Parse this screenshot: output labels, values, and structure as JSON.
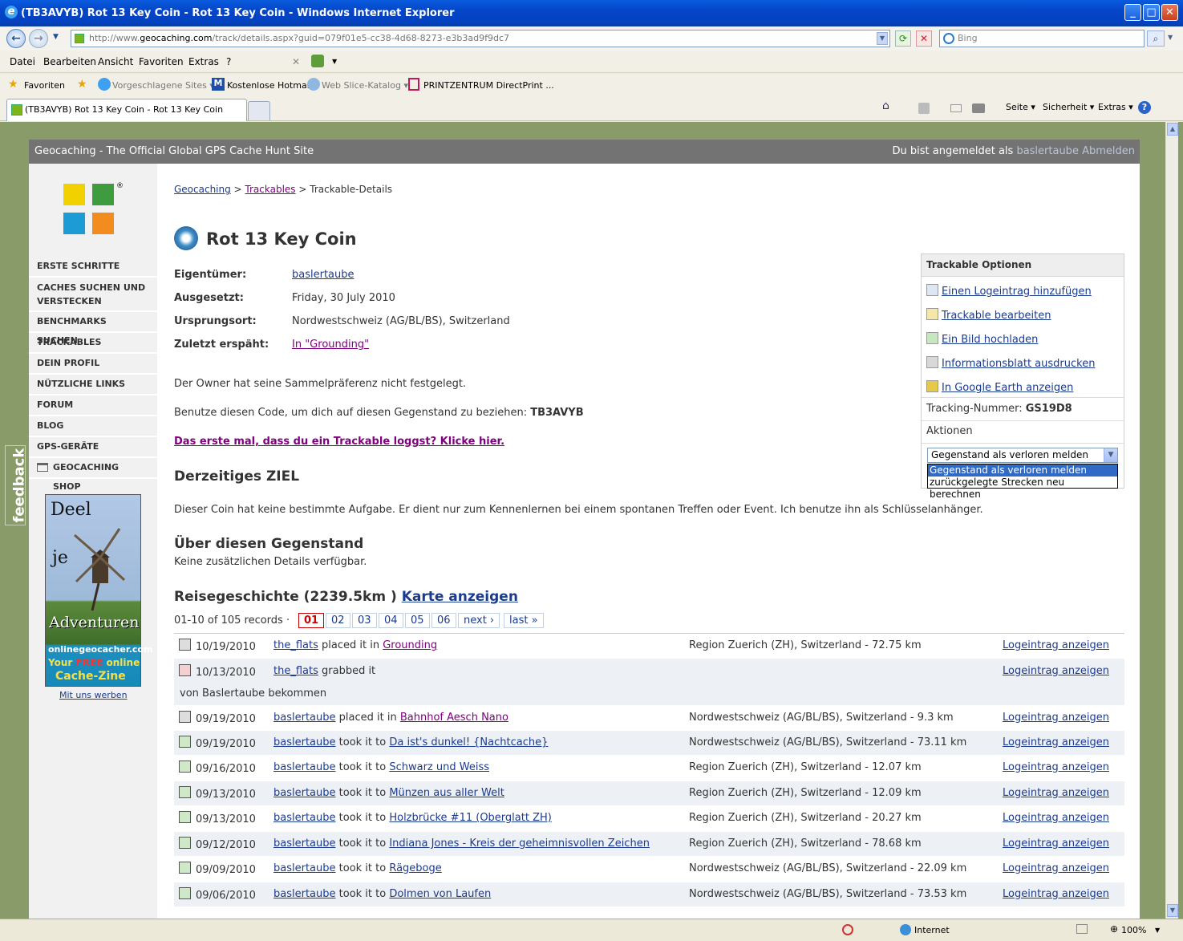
{
  "window": {
    "title": "(TB3AVYB) Rot 13 Key Coin - Rot 13 Key Coin - Windows Internet Explorer"
  },
  "browser": {
    "url_prefix": "http://www.",
    "url_domain": "geocaching.com",
    "url_rest": "/track/details.aspx?guid=079f01e5-cc38-4d68-8273-e3b3ad9f9dc7",
    "search_placeholder": "Bing",
    "menu": [
      "Datei",
      "Bearbeiten",
      "Ansicht",
      "Favoriten",
      "Extras",
      "?"
    ],
    "favorites_label": "Favoriten",
    "favorites": [
      "Vorgeschlagene Sites ▾",
      "Kostenlose Hotmail",
      "Web Slice-Katalog ▾",
      "PRINTZENTRUM DirectPrint ..."
    ],
    "tab_title": "(TB3AVYB) Rot 13 Key Coin - Rot 13 Key Coin",
    "tools": [
      "Seite ▾",
      "Sicherheit ▾",
      "Extras ▾"
    ],
    "status_zone": "Internet",
    "zoom": "100%"
  },
  "site": {
    "header_title": "Geocaching - The Official Global GPS Cache Hunt Site",
    "logged_in_prefix": "Du bist angemeldet als",
    "username": "baslertaube",
    "logout": "Abmelden"
  },
  "sidebar": {
    "items": [
      "ERSTE SCHRITTE",
      "CACHES SUCHEN UND VERSTECKEN",
      "BENCHMARKS SUCHEN",
      "TRACKABLES",
      "DEIN PROFIL",
      "NÜTZLICHE LINKS",
      "FORUM",
      "BLOG",
      "GPS-GERÄTE",
      "GEOCACHING SHOP"
    ],
    "ad_lines": [
      "Deel",
      "je",
      "Adventuren",
      "onlinegeocacher.com",
      "Your",
      "FREE",
      "online",
      "Cache-Zine"
    ],
    "ad_link": "Mit uns werben",
    "feedback": "feedback"
  },
  "breadcrumb": {
    "home": "Geocaching",
    "trackables": "Trackables",
    "current": "Trackable-Details"
  },
  "trackable": {
    "name": "Rot 13 Key Coin",
    "fields": [
      {
        "label": "Eigentümer:",
        "value": "baslertaube"
      },
      {
        "label": "Ausgesetzt:",
        "value": "Friday, 30 July 2010"
      },
      {
        "label": "Ursprungsort:",
        "value": "Nordwestschweiz (AG/BL/BS), Switzerland"
      },
      {
        "label": "Zuletzt erspäht:",
        "value": "In \"Grounding\""
      }
    ],
    "collect_pref": "Der Owner hat seine Sammelpräferenz nicht festgelegt.",
    "code_text": "Benutze diesen Code, um dich auf diesen Gegenstand zu beziehen:",
    "code": "TB3AVYB",
    "first_log_link": "Das erste mal, dass du ein Trackable loggst? Klicke hier.",
    "goal_heading": "Derzeitiges ZIEL",
    "goal_text": "Dieser Coin hat keine bestimmte Aufgabe. Er dient nur zum Kennenlernen bei einem spontanen Treffen oder Event. Ich benutze ihn als Schlüsselanhänger.",
    "about_heading": "Über diesen Gegenstand",
    "about_text": "Keine zusätzlichen Details verfügbar.",
    "travel_heading": "Reisegeschichte (2239.5km )",
    "map_link": "Karte anzeigen"
  },
  "options": {
    "title": "Trackable Optionen",
    "links": [
      "Einen Logeintrag hinzufügen",
      "Trackable bearbeiten",
      "Ein Bild hochladen",
      "Informationsblatt ausdrucken",
      "In Google Earth anzeigen"
    ],
    "tracking_label": "Tracking-Nummer:",
    "tracking_number": "GS19D8",
    "actions_label": "Aktionen",
    "select_value": "Gegenstand als verloren melden",
    "select_options": [
      "Gegenstand als verloren melden",
      "zurückgelegte Strecken neu berechnen"
    ]
  },
  "pager": {
    "records": "01-10 of 105 records ·",
    "pages": [
      "01",
      "02",
      "03",
      "04",
      "05",
      "06"
    ],
    "current": "01",
    "next": "next ›",
    "last": "last »"
  },
  "logs": [
    {
      "date": "10/19/2010",
      "user": "the_flats",
      "action": "placed it in",
      "target": "Grounding",
      "target_visited": true,
      "location": "Region Zuerich (ZH), Switzerland - 72.75 km",
      "link": "Logeintrag anzeigen"
    },
    {
      "date": "10/13/2010",
      "user": "the_flats",
      "action": "grabbed it",
      "target": "",
      "location": "",
      "note": "von Baslertaube bekommen",
      "link": "Logeintrag anzeigen"
    },
    {
      "date": "09/19/2010",
      "user": "baslertaube",
      "action": "placed it in",
      "target": "Bahnhof Aesch Nano",
      "target_visited": true,
      "location": "Nordwestschweiz (AG/BL/BS), Switzerland - 9.3 km",
      "link": "Logeintrag anzeigen"
    },
    {
      "date": "09/19/2010",
      "user": "baslertaube",
      "action": "took it to",
      "target": "Da ist's dunkel! {Nachtcache}",
      "location": "Nordwestschweiz (AG/BL/BS), Switzerland - 73.11 km",
      "link": "Logeintrag anzeigen"
    },
    {
      "date": "09/16/2010",
      "user": "baslertaube",
      "action": "took it to",
      "target": "Schwarz und Weiss",
      "location": "Region Zuerich (ZH), Switzerland - 12.07 km",
      "link": "Logeintrag anzeigen"
    },
    {
      "date": "09/13/2010",
      "user": "baslertaube",
      "action": "took it to",
      "target": "Münzen aus aller Welt",
      "location": "Region Zuerich (ZH), Switzerland - 12.09 km",
      "link": "Logeintrag anzeigen"
    },
    {
      "date": "09/13/2010",
      "user": "baslertaube",
      "action": "took it to",
      "target": "Holzbrücke #11 (Oberglatt ZH)",
      "location": "Region Zuerich (ZH), Switzerland - 20.27 km",
      "link": "Logeintrag anzeigen"
    },
    {
      "date": "09/12/2010",
      "user": "baslertaube",
      "action": "took it to",
      "target": "Indiana Jones - Kreis der geheimnisvollen Zeichen",
      "location": "Region Zuerich (ZH), Switzerland - 78.68 km",
      "link": "Logeintrag anzeigen"
    },
    {
      "date": "09/09/2010",
      "user": "baslertaube",
      "action": "took it to",
      "target": "Rägeboge",
      "location": "Nordwestschweiz (AG/BL/BS), Switzerland - 22.09 km",
      "link": "Logeintrag anzeigen"
    },
    {
      "date": "09/06/2010",
      "user": "baslertaube",
      "action": "took it to",
      "target": "Dolmen von Laufen",
      "location": "Nordwestschweiz (AG/BL/BS), Switzerland - 73.53 km",
      "link": "Logeintrag anzeigen"
    }
  ]
}
